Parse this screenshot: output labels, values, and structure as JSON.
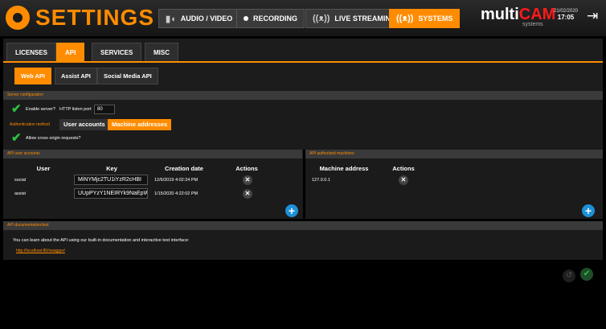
{
  "header": {
    "title": "SETTINGS",
    "nav": [
      {
        "label": "AUDIO / VIDEO",
        "icon": "audio-video-icon"
      },
      {
        "label": "RECORDING",
        "icon": "record-dot-icon"
      },
      {
        "label": "LIVE STREAMING",
        "icon": "broadcast-icon"
      },
      {
        "label": "SYSTEMS",
        "icon": "broadcast-icon",
        "active": true
      }
    ],
    "logo_a": "multi",
    "logo_b": "CAM",
    "logo_sub": "systems",
    "date": "21/02/2020",
    "time": "17:05"
  },
  "tabs": [
    "LICENSES",
    "API",
    "SERVICES",
    "MISC"
  ],
  "active_tab": "API",
  "subtabs": [
    "Web API",
    "Assist API",
    "Social Media API"
  ],
  "active_subtab": "Web API",
  "server_config": {
    "heading": "Server configuration",
    "enable_label": "Enable server?",
    "port_label": "HTTP listen port",
    "port_value": "80",
    "auth_label": "Authentication method",
    "auth_options": [
      "User accounts",
      "Machine addresses"
    ],
    "auth_selected": "Machine addresses",
    "cors_label": "Allow cross origin requests?"
  },
  "users": {
    "heading": "API user accounts",
    "columns": [
      "User",
      "Key",
      "Creation date",
      "Actions"
    ],
    "rows": [
      {
        "user": "social",
        "key": "MiNYMjc2TU1iYzR2cHBI",
        "date": "12/6/2019 4:02:24 PM"
      },
      {
        "user": "assist",
        "key": "UUpPYzY1NEIRYk9NaEpW",
        "date": "1/15/2020 4:22:02 PM"
      }
    ]
  },
  "machines": {
    "heading": "API authorised machines",
    "columns": [
      "Machine address",
      "Actions"
    ],
    "rows": [
      {
        "address": "127.0.0.1"
      }
    ]
  },
  "docs": {
    "heading": "API documentation/test",
    "text": "You can learn about the API using our built-in documentation and interactive test interface:",
    "link": "http://localhost:80/swagger/"
  },
  "colors": {
    "accent": "#ff8c00",
    "check": "#2fbf3f",
    "add": "#1e90d8"
  }
}
